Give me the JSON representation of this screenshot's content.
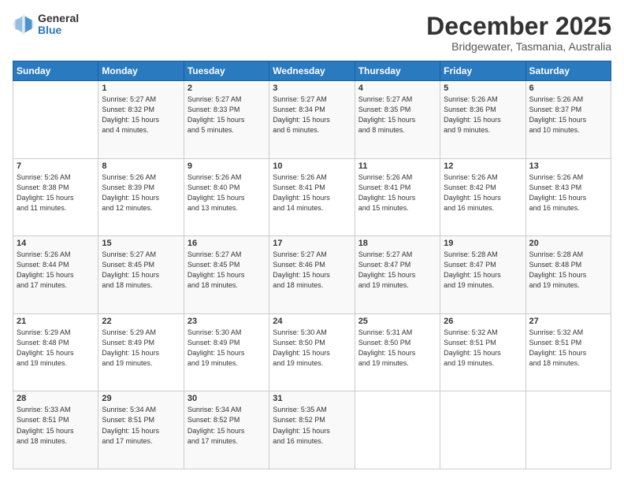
{
  "header": {
    "logo_general": "General",
    "logo_blue": "Blue",
    "month_title": "December 2025",
    "location": "Bridgewater, Tasmania, Australia"
  },
  "days_of_week": [
    "Sunday",
    "Monday",
    "Tuesday",
    "Wednesday",
    "Thursday",
    "Friday",
    "Saturday"
  ],
  "weeks": [
    [
      {
        "day": "",
        "info": ""
      },
      {
        "day": "1",
        "info": "Sunrise: 5:27 AM\nSunset: 8:32 PM\nDaylight: 15 hours\nand 4 minutes."
      },
      {
        "day": "2",
        "info": "Sunrise: 5:27 AM\nSunset: 8:33 PM\nDaylight: 15 hours\nand 5 minutes."
      },
      {
        "day": "3",
        "info": "Sunrise: 5:27 AM\nSunset: 8:34 PM\nDaylight: 15 hours\nand 6 minutes."
      },
      {
        "day": "4",
        "info": "Sunrise: 5:27 AM\nSunset: 8:35 PM\nDaylight: 15 hours\nand 8 minutes."
      },
      {
        "day": "5",
        "info": "Sunrise: 5:26 AM\nSunset: 8:36 PM\nDaylight: 15 hours\nand 9 minutes."
      },
      {
        "day": "6",
        "info": "Sunrise: 5:26 AM\nSunset: 8:37 PM\nDaylight: 15 hours\nand 10 minutes."
      }
    ],
    [
      {
        "day": "7",
        "info": "Sunrise: 5:26 AM\nSunset: 8:38 PM\nDaylight: 15 hours\nand 11 minutes."
      },
      {
        "day": "8",
        "info": "Sunrise: 5:26 AM\nSunset: 8:39 PM\nDaylight: 15 hours\nand 12 minutes."
      },
      {
        "day": "9",
        "info": "Sunrise: 5:26 AM\nSunset: 8:40 PM\nDaylight: 15 hours\nand 13 minutes."
      },
      {
        "day": "10",
        "info": "Sunrise: 5:26 AM\nSunset: 8:41 PM\nDaylight: 15 hours\nand 14 minutes."
      },
      {
        "day": "11",
        "info": "Sunrise: 5:26 AM\nSunset: 8:41 PM\nDaylight: 15 hours\nand 15 minutes."
      },
      {
        "day": "12",
        "info": "Sunrise: 5:26 AM\nSunset: 8:42 PM\nDaylight: 15 hours\nand 16 minutes."
      },
      {
        "day": "13",
        "info": "Sunrise: 5:26 AM\nSunset: 8:43 PM\nDaylight: 15 hours\nand 16 minutes."
      }
    ],
    [
      {
        "day": "14",
        "info": "Sunrise: 5:26 AM\nSunset: 8:44 PM\nDaylight: 15 hours\nand 17 minutes."
      },
      {
        "day": "15",
        "info": "Sunrise: 5:27 AM\nSunset: 8:45 PM\nDaylight: 15 hours\nand 18 minutes."
      },
      {
        "day": "16",
        "info": "Sunrise: 5:27 AM\nSunset: 8:45 PM\nDaylight: 15 hours\nand 18 minutes."
      },
      {
        "day": "17",
        "info": "Sunrise: 5:27 AM\nSunset: 8:46 PM\nDaylight: 15 hours\nand 18 minutes."
      },
      {
        "day": "18",
        "info": "Sunrise: 5:27 AM\nSunset: 8:47 PM\nDaylight: 15 hours\nand 19 minutes."
      },
      {
        "day": "19",
        "info": "Sunrise: 5:28 AM\nSunset: 8:47 PM\nDaylight: 15 hours\nand 19 minutes."
      },
      {
        "day": "20",
        "info": "Sunrise: 5:28 AM\nSunset: 8:48 PM\nDaylight: 15 hours\nand 19 minutes."
      }
    ],
    [
      {
        "day": "21",
        "info": "Sunrise: 5:29 AM\nSunset: 8:48 PM\nDaylight: 15 hours\nand 19 minutes."
      },
      {
        "day": "22",
        "info": "Sunrise: 5:29 AM\nSunset: 8:49 PM\nDaylight: 15 hours\nand 19 minutes."
      },
      {
        "day": "23",
        "info": "Sunrise: 5:30 AM\nSunset: 8:49 PM\nDaylight: 15 hours\nand 19 minutes."
      },
      {
        "day": "24",
        "info": "Sunrise: 5:30 AM\nSunset: 8:50 PM\nDaylight: 15 hours\nand 19 minutes."
      },
      {
        "day": "25",
        "info": "Sunrise: 5:31 AM\nSunset: 8:50 PM\nDaylight: 15 hours\nand 19 minutes."
      },
      {
        "day": "26",
        "info": "Sunrise: 5:32 AM\nSunset: 8:51 PM\nDaylight: 15 hours\nand 19 minutes."
      },
      {
        "day": "27",
        "info": "Sunrise: 5:32 AM\nSunset: 8:51 PM\nDaylight: 15 hours\nand 18 minutes."
      }
    ],
    [
      {
        "day": "28",
        "info": "Sunrise: 5:33 AM\nSunset: 8:51 PM\nDaylight: 15 hours\nand 18 minutes."
      },
      {
        "day": "29",
        "info": "Sunrise: 5:34 AM\nSunset: 8:51 PM\nDaylight: 15 hours\nand 17 minutes."
      },
      {
        "day": "30",
        "info": "Sunrise: 5:34 AM\nSunset: 8:52 PM\nDaylight: 15 hours\nand 17 minutes."
      },
      {
        "day": "31",
        "info": "Sunrise: 5:35 AM\nSunset: 8:52 PM\nDaylight: 15 hours\nand 16 minutes."
      },
      {
        "day": "",
        "info": ""
      },
      {
        "day": "",
        "info": ""
      },
      {
        "day": "",
        "info": ""
      }
    ]
  ]
}
